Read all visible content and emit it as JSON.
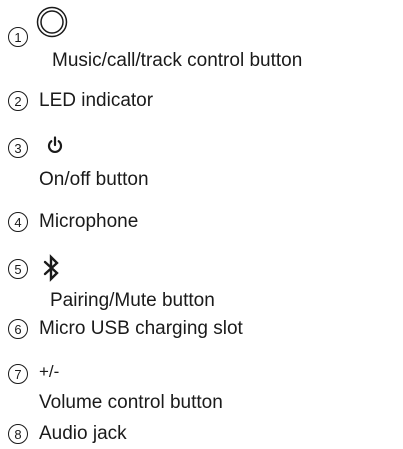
{
  "items": [
    {
      "number": "1",
      "icon": "multifunction-button-icon",
      "label": "Music/call/track control button"
    },
    {
      "number": "2",
      "icon": "",
      "label": "LED indicator"
    },
    {
      "number": "3",
      "icon": "power-icon",
      "label": "On/off button"
    },
    {
      "number": "4",
      "icon": "",
      "label": "Microphone"
    },
    {
      "number": "5",
      "icon": "bluetooth-icon",
      "label": "Pairing/Mute button"
    },
    {
      "number": "6",
      "icon": "",
      "label": "Micro USB charging slot"
    },
    {
      "number": "7",
      "icon": "",
      "symbol": "+/-",
      "label": "Volume control button"
    },
    {
      "number": "8",
      "icon": "",
      "label": "Audio jack"
    }
  ]
}
